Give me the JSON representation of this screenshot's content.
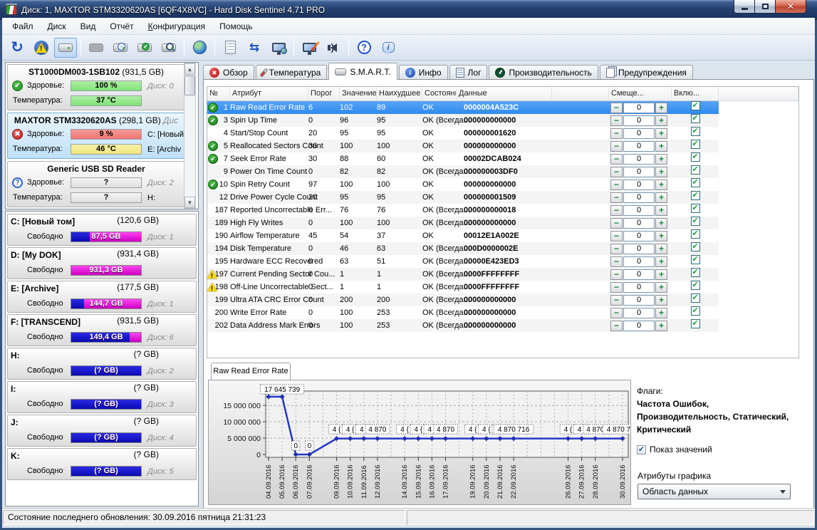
{
  "window": {
    "title": "Диск: 1, MAXTOR STM3320620AS [6QF4X8VC]  -  Hard Disk Sentinel 4.71 PRO"
  },
  "menu": {
    "items": [
      {
        "label": "Файл"
      },
      {
        "label": "Диск"
      },
      {
        "label": "Вид"
      },
      {
        "label": "Отчёт"
      },
      {
        "label": "Конфигурация",
        "underline_first": true
      },
      {
        "label": "Помощь"
      }
    ]
  },
  "toolbar": {
    "icons": [
      "refresh",
      "disk-alert",
      "disk-overview",
      "disk-disabled",
      "disk-clock",
      "disk-accept",
      "disk-search",
      "network-disk",
      "report",
      "sync",
      "remote-computer",
      "surface-test",
      "acoustic",
      "help",
      "about"
    ]
  },
  "sidebar": {
    "health_label": "Здоровье:",
    "temp_label": "Температура:",
    "free_label": "Свободно",
    "disks": [
      {
        "name": "ST1000DM003-1SB102",
        "size": "(931,5 GB)",
        "extra": "",
        "status": "ok",
        "health": "100 %",
        "health_color": "green",
        "temp": "37 °C",
        "temp_color": "green",
        "note1": "Диск: 0",
        "note1_gray": true,
        "note2": "",
        "note2_gray": true,
        "selected": false
      },
      {
        "name": "MAXTOR STM3320620AS",
        "size": "(298,1 GB)",
        "extra": "Дис",
        "status": "error",
        "health": "9 %",
        "health_color": "red",
        "temp": "46 °C",
        "temp_color": "yellow",
        "note1": "C: [Новый",
        "note1_gray": false,
        "note2": "E: [Archiv",
        "note2_gray": false,
        "selected": true
      },
      {
        "name": "Generic USB SD Reader",
        "size": "",
        "extra": "",
        "status": "unknown",
        "health": "?",
        "health_color": "none",
        "temp": "?",
        "temp_color": "none",
        "note1": "Диск: 2",
        "note1_gray": true,
        "note2": "H:",
        "note2_gray": false,
        "selected": false
      }
    ],
    "partitions": [
      {
        "drive": "C: [Новый том]",
        "size": "(120,6 GB)",
        "free": "87,5 GB",
        "note": "Диск: 1",
        "free_pct": 73
      },
      {
        "drive": "D: [My DOK]",
        "size": "(931,4 GB)",
        "free": "931,3 GB",
        "note": "",
        "free_pct": 100
      },
      {
        "drive": "E: [Archive]",
        "size": "(177,5 GB)",
        "free": "144,7 GB",
        "note": "Диск: 1",
        "free_pct": 82
      },
      {
        "drive": "F: [TRANSCEND]",
        "size": "(931,5 GB)",
        "free": "149,4 GB",
        "note": "Диск: 6",
        "free_pct": 16
      },
      {
        "drive": "H:",
        "size": "(? GB)",
        "free": "(? GB)",
        "note": "Диск: 2",
        "free_pct": 0
      },
      {
        "drive": "I:",
        "size": "(? GB)",
        "free": "(? GB)",
        "note": "Диск: 3",
        "free_pct": 0
      },
      {
        "drive": "J:",
        "size": "(? GB)",
        "free": "(? GB)",
        "note": "Диск: 4",
        "free_pct": 0
      },
      {
        "drive": "K:",
        "size": "(? GB)",
        "free": "(? GB)",
        "note": "Диск: 5",
        "free_pct": 0
      }
    ]
  },
  "tabs": {
    "active_index": 2,
    "items": [
      {
        "label": "Обзор",
        "icon": "error-icon"
      },
      {
        "label": "Температура",
        "icon": "thermometer-icon"
      },
      {
        "label": "S.M.A.R.T.",
        "icon": "disk-icon"
      },
      {
        "label": "Инфо",
        "icon": "info-icon"
      },
      {
        "label": "Лог",
        "icon": "log-icon"
      },
      {
        "label": "Производительность",
        "icon": "gauge-icon"
      },
      {
        "label": "Предупреждения",
        "icon": "pages-icon"
      }
    ]
  },
  "smart": {
    "headers": [
      "№",
      "Атрибут",
      "Порог",
      "Значение",
      "Наихудшее",
      "Состояние",
      "Данные",
      "",
      "Смеще...",
      "Вклю...",
      ""
    ],
    "rows": [
      {
        "icon": "ok",
        "num": "1",
        "attr": "Raw Read Error Rate",
        "thresh": "6",
        "value": "102",
        "worst": "89",
        "status": "OK",
        "data": "0000004A523C",
        "offset": "0",
        "checked": true,
        "selected": true
      },
      {
        "icon": "ok",
        "num": "3",
        "attr": "Spin Up Time",
        "thresh": "0",
        "value": "96",
        "worst": "95",
        "status": "OK (Всегда...",
        "data": "000000000000",
        "offset": "0",
        "checked": true,
        "selected": false
      },
      {
        "icon": "none",
        "num": "4",
        "attr": "Start/Stop Count",
        "thresh": "20",
        "value": "95",
        "worst": "95",
        "status": "OK",
        "data": "000000001620",
        "offset": "0",
        "checked": true,
        "selected": false
      },
      {
        "icon": "ok",
        "num": "5",
        "attr": "Reallocated Sectors Count",
        "thresh": "36",
        "value": "100",
        "worst": "100",
        "status": "OK",
        "data": "000000000000",
        "offset": "0",
        "checked": true,
        "selected": false
      },
      {
        "icon": "ok",
        "num": "7",
        "attr": "Seek Error Rate",
        "thresh": "30",
        "value": "88",
        "worst": "60",
        "status": "OK",
        "data": "00002DCAB024",
        "offset": "0",
        "checked": true,
        "selected": false
      },
      {
        "icon": "none",
        "num": "9",
        "attr": "Power On Time Count",
        "thresh": "0",
        "value": "82",
        "worst": "82",
        "status": "OK (Всегда...",
        "data": "000000003DF0",
        "offset": "0",
        "checked": true,
        "selected": false
      },
      {
        "icon": "ok",
        "num": "10",
        "attr": "Spin Retry Count",
        "thresh": "97",
        "value": "100",
        "worst": "100",
        "status": "OK",
        "data": "000000000000",
        "offset": "0",
        "checked": true,
        "selected": false
      },
      {
        "icon": "none",
        "num": "12",
        "attr": "Drive Power Cycle Count",
        "thresh": "20",
        "value": "95",
        "worst": "95",
        "status": "OK",
        "data": "000000001509",
        "offset": "0",
        "checked": true,
        "selected": false
      },
      {
        "icon": "none",
        "num": "187",
        "attr": "Reported Uncorrectable Err...",
        "thresh": "0",
        "value": "76",
        "worst": "76",
        "status": "OK (Всегда...",
        "data": "000000000018",
        "offset": "0",
        "checked": true,
        "selected": false
      },
      {
        "icon": "none",
        "num": "189",
        "attr": "High Fly Writes",
        "thresh": "0",
        "value": "100",
        "worst": "100",
        "status": "OK (Всегда...",
        "data": "000000000000",
        "offset": "0",
        "checked": true,
        "selected": false
      },
      {
        "icon": "none",
        "num": "190",
        "attr": "Airflow Temperature",
        "thresh": "45",
        "value": "54",
        "worst": "37",
        "status": "OK",
        "data": "00012E1A002E",
        "offset": "0",
        "checked": true,
        "selected": false
      },
      {
        "icon": "none",
        "num": "194",
        "attr": "Disk Temperature",
        "thresh": "0",
        "value": "46",
        "worst": "63",
        "status": "OK (Всегда...",
        "data": "000D0000002E",
        "offset": "0",
        "checked": true,
        "selected": false
      },
      {
        "icon": "none",
        "num": "195",
        "attr": "Hardware ECC Recovered",
        "thresh": "0",
        "value": "63",
        "worst": "51",
        "status": "OK (Всегда...",
        "data": "00000E423ED3",
        "offset": "0",
        "checked": true,
        "selected": false
      },
      {
        "icon": "warn",
        "num": "197",
        "attr": "Current Pending Sector Cou...",
        "thresh": "0",
        "value": "1",
        "worst": "1",
        "status": "OK (Всегда...",
        "data": "0000FFFFFFFF",
        "offset": "0",
        "checked": true,
        "selected": false
      },
      {
        "icon": "warn",
        "num": "198",
        "attr": "Off-Line Uncorrectable Sect...",
        "thresh": "0",
        "value": "1",
        "worst": "1",
        "status": "OK (Всегда...",
        "data": "0000FFFFFFFF",
        "offset": "0",
        "checked": true,
        "selected": false
      },
      {
        "icon": "none",
        "num": "199",
        "attr": "Ultra ATA CRC Error Count",
        "thresh": "0",
        "value": "200",
        "worst": "200",
        "status": "OK (Всегда...",
        "data": "000000000000",
        "offset": "0",
        "checked": true,
        "selected": false
      },
      {
        "icon": "none",
        "num": "200",
        "attr": "Write Error Rate",
        "thresh": "0",
        "value": "100",
        "worst": "253",
        "status": "OK (Всегда...",
        "data": "000000000000",
        "offset": "0",
        "checked": true,
        "selected": false
      },
      {
        "icon": "none",
        "num": "202",
        "attr": "Data Address Mark Errors",
        "thresh": "0",
        "value": "100",
        "worst": "253",
        "status": "OK (Всегда...",
        "data": "000000000000",
        "offset": "0",
        "checked": true,
        "selected": false
      }
    ]
  },
  "chart_tab": "Raw Read Error Rate",
  "chart_data": {
    "type": "line",
    "title": "Raw Read Error Rate",
    "ylim": [
      0,
      18500000
    ],
    "yticks": [
      0,
      5000000,
      10000000,
      15000000
    ],
    "ytick_labels": [
      "0",
      "5 000 000",
      "10 000 000",
      "15 000 000"
    ],
    "total_slots": 27,
    "grid": true,
    "line_color": "#2438c8",
    "points": [
      {
        "slot": 0,
        "date": "04.09.2016",
        "value": 17645739,
        "label": "17"
      },
      {
        "slot": 1,
        "date": "05.09.2016",
        "value": 17645739,
        "label": "17 645 739"
      },
      {
        "slot": 2,
        "date": "06.09.2016",
        "value": 0,
        "label": "0"
      },
      {
        "slot": 3,
        "date": "07.09.2016",
        "value": 0,
        "label": "0"
      },
      {
        "slot": 5,
        "date": "09.09.2016",
        "value": 4870716,
        "label": "4 {"
      },
      {
        "slot": 6,
        "date": "10.09.2016",
        "value": 4870716,
        "label": "4 {"
      },
      {
        "slot": 7,
        "date": "11.09.2016",
        "value": 4870716,
        "label": "4 {"
      },
      {
        "slot": 8,
        "date": "12.09.2016",
        "value": 4870716,
        "label": "4 870"
      },
      {
        "slot": 10,
        "date": "14.09.2016",
        "value": 4870716,
        "label": "4 {"
      },
      {
        "slot": 11,
        "date": "15.09.2016",
        "value": 4870716,
        "label": "4 {"
      },
      {
        "slot": 12,
        "date": "16.09.2016",
        "value": 4870716,
        "label": "4 {"
      },
      {
        "slot": 13,
        "date": "17.09.2016",
        "value": 4870716,
        "label": "4 870"
      },
      {
        "slot": 15,
        "date": "19.09.2016",
        "value": 4870716,
        "label": "4 {"
      },
      {
        "slot": 16,
        "date": "20.09.2016",
        "value": 4870716,
        "label": "4 {"
      },
      {
        "slot": 17,
        "date": "21.09.2016",
        "value": 4870716,
        "label": "4 {"
      },
      {
        "slot": 18,
        "date": "22.09.2016",
        "value": 4870716,
        "label": "4 870 716"
      },
      {
        "slot": 22,
        "date": "26.09.2016",
        "value": 4870716,
        "label": "4 {"
      },
      {
        "slot": 23,
        "date": "27.09.2016",
        "value": 4870716,
        "label": "4 {"
      },
      {
        "slot": 24,
        "date": "28.09.2016",
        "value": 4870716,
        "label": "4 870"
      },
      {
        "slot": 26,
        "date": "30.09.2016",
        "value": 4870716,
        "label": "4 870 716"
      }
    ]
  },
  "flags_panel": {
    "title": "Флаги:",
    "lines": [
      "Частота Ошибок,",
      "Производительность, Статический,",
      "Критический"
    ],
    "show_values_label": "Показ значений",
    "show_values_checked": true,
    "graph_attrs_label": "Атрибуты графика",
    "graph_attr_selected": "Область данных"
  },
  "status_bar": {
    "text": "Состояние последнего обновления: 30.09.2016 пятница 21:31:23"
  }
}
